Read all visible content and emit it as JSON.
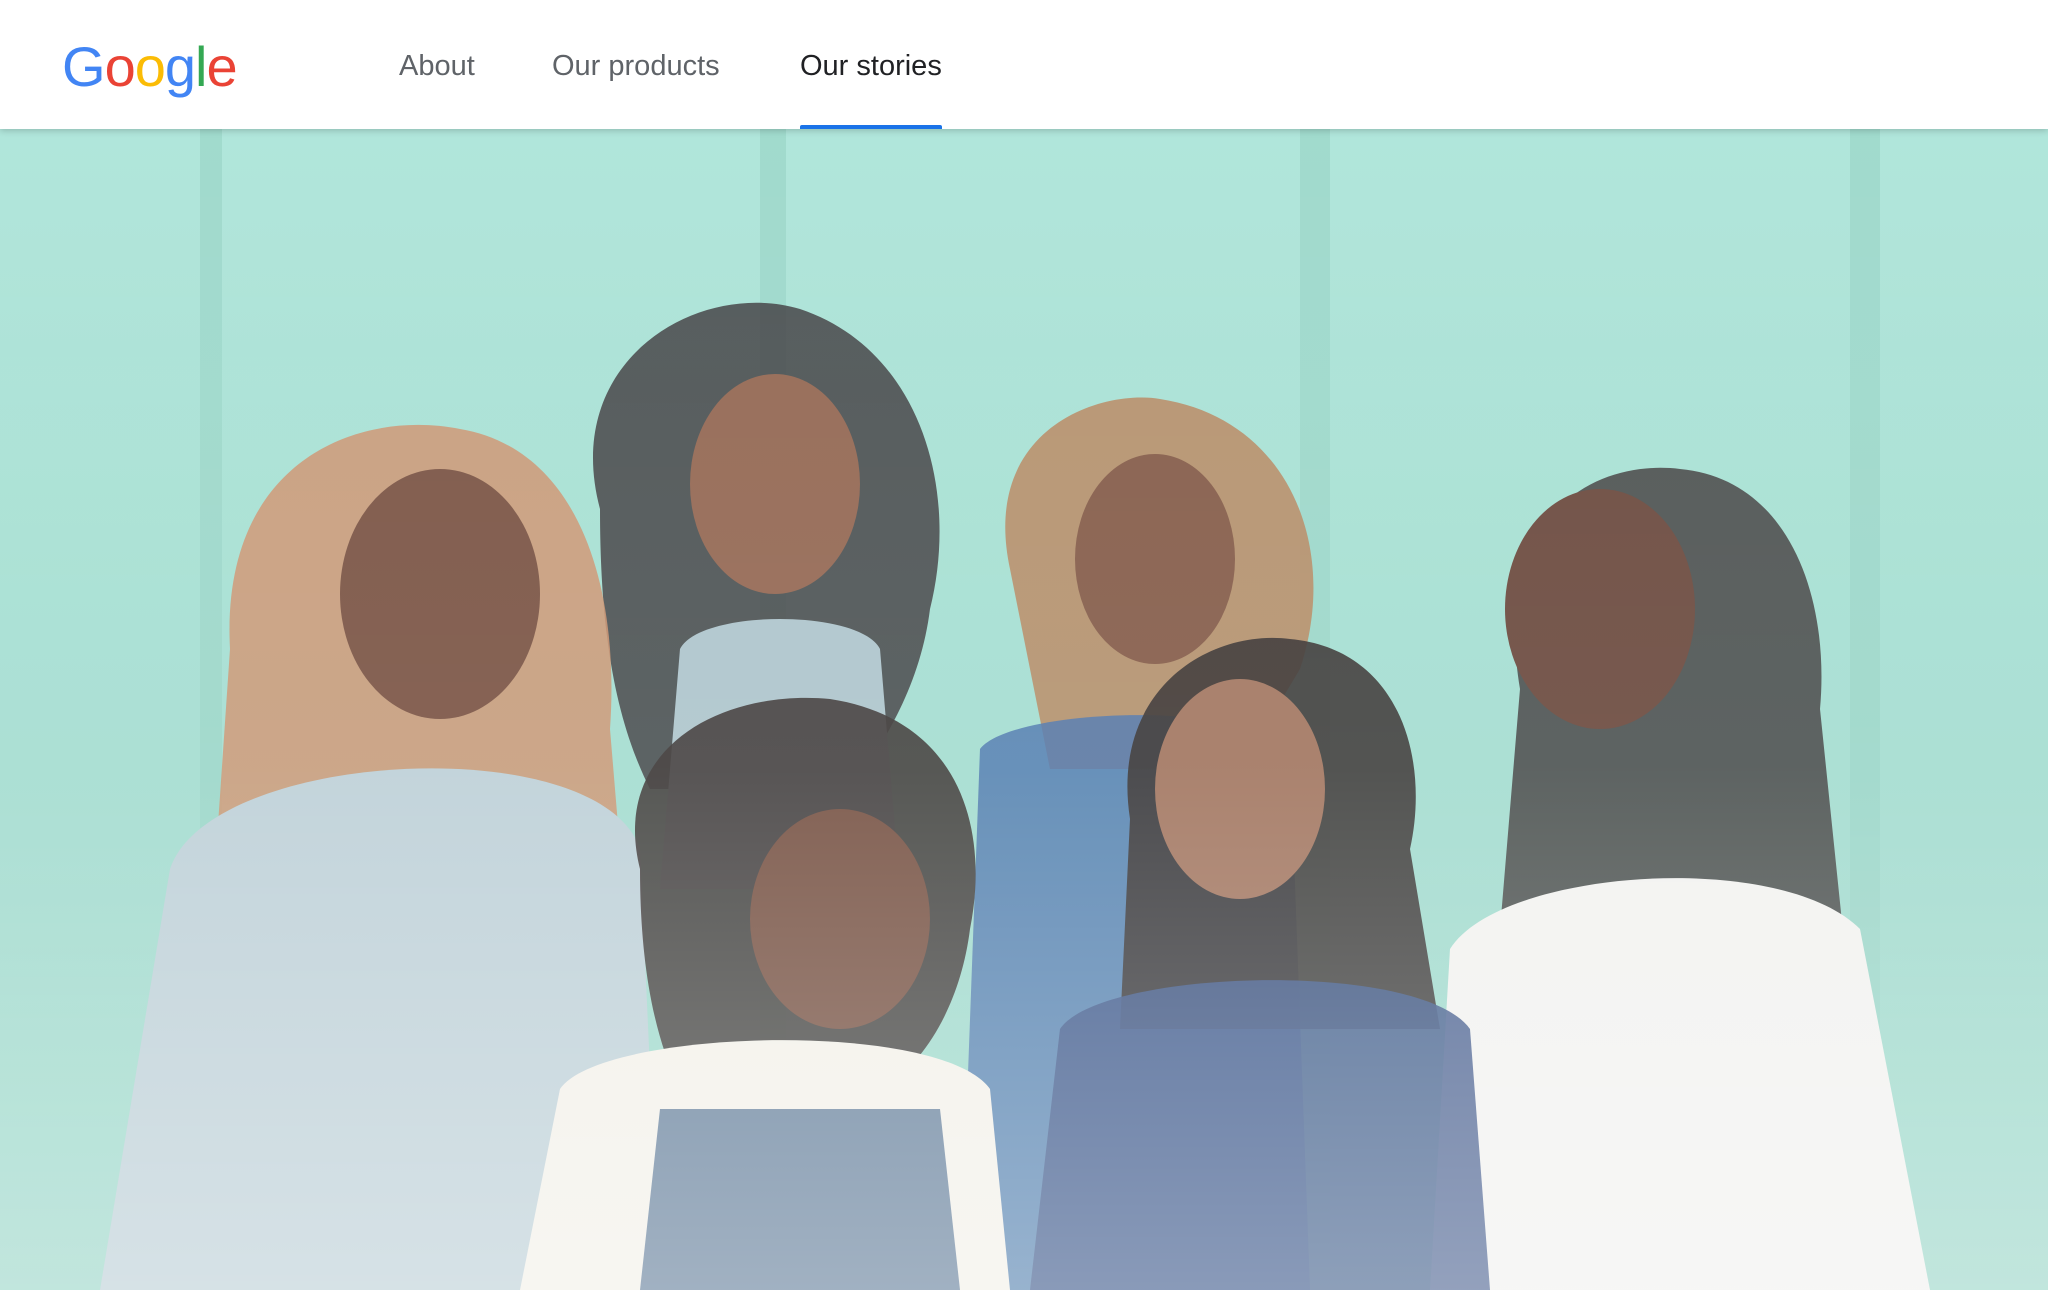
{
  "header": {
    "logo": {
      "letters": [
        "G",
        "o",
        "o",
        "g",
        "l",
        "e"
      ],
      "colors": [
        "#4285F4",
        "#EA4335",
        "#FBBC05",
        "#4285F4",
        "#34A853",
        "#EA4335"
      ]
    },
    "nav": [
      {
        "label": "About",
        "active": false
      },
      {
        "label": "Our products",
        "active": false
      },
      {
        "label": "Our stories",
        "active": true
      }
    ],
    "active_color": "#1a73e8"
  },
  "hero": {
    "image": "photo of six smiling women and girls in front of a mint-green wall",
    "wall_color": "#9fdccf"
  }
}
